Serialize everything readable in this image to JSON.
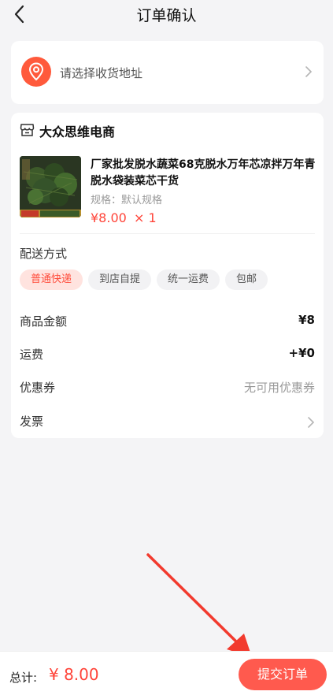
{
  "header": {
    "title": "订单确认"
  },
  "address": {
    "placeholder": "请选择收货地址"
  },
  "shop": {
    "name": "大众思维电商"
  },
  "product": {
    "title": "厂家批发脱水蔬菜68克脱水万年芯凉拌万年青脱水袋装菜芯干货",
    "spec": "规格：默认规格",
    "price": "¥8.00",
    "qty": "× 1"
  },
  "shipping": {
    "label": "配送方式",
    "options": [
      "普通快递",
      "到店自提",
      "统一运费",
      "包邮"
    ],
    "selected": "普通快递"
  },
  "summary": {
    "goods_label": "商品金额",
    "goods_value": "¥8",
    "freight_label": "运费",
    "freight_value": "+¥0",
    "coupon_label": "优惠券",
    "coupon_value": "无可用优惠券",
    "invoice_label": "发票"
  },
  "footer": {
    "total_label": "总计:",
    "total_amount": "¥ 8.00",
    "submit_label": "提交订单"
  },
  "colors": {
    "accent": "#ff4439",
    "button": "#ff5a4e",
    "chip_active_bg": "#ffe3df"
  },
  "icons": [
    "back-arrow-icon",
    "location-pin-icon",
    "chevron-right-icon",
    "store-icon",
    "arrow-annotation"
  ]
}
